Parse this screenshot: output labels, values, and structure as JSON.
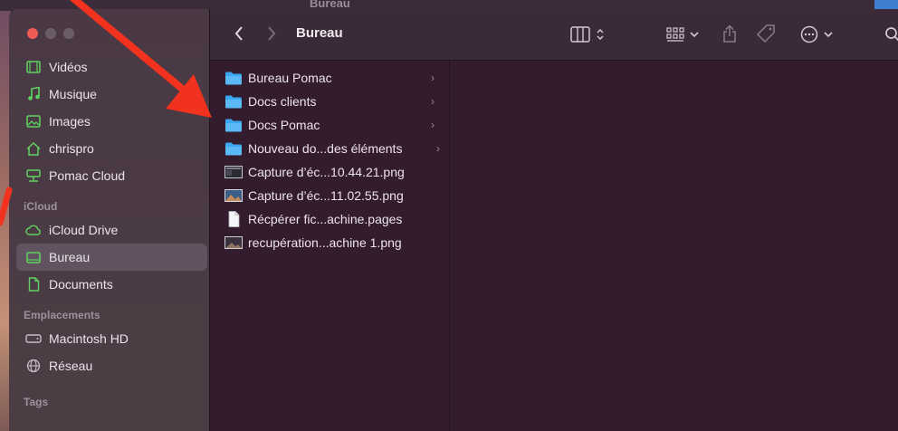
{
  "window": {
    "title": "Bureau"
  },
  "sidebar": {
    "items_top": [
      {
        "label": "Vidéos",
        "icon": "film-icon"
      },
      {
        "label": "Musique",
        "icon": "music-note-icon"
      },
      {
        "label": "Images",
        "icon": "photo-icon"
      },
      {
        "label": "chrispro",
        "icon": "home-icon"
      },
      {
        "label": "Pomac Cloud",
        "icon": "network-drive-icon"
      }
    ],
    "section_icloud": "iCloud",
    "items_icloud": [
      {
        "label": "iCloud Drive",
        "icon": "cloud-icon"
      },
      {
        "label": "Bureau",
        "icon": "desktop-icon",
        "selected": true
      },
      {
        "label": "Documents",
        "icon": "document-icon"
      }
    ],
    "section_locations": "Emplacements",
    "items_locations": [
      {
        "label": "Macintosh HD",
        "icon": "hard-drive-icon"
      },
      {
        "label": "Réseau",
        "icon": "globe-icon"
      }
    ],
    "section_tags": "Tags"
  },
  "files": [
    {
      "name": "Bureau Pomac",
      "type": "folder"
    },
    {
      "name": "Docs clients",
      "type": "folder"
    },
    {
      "name": "Docs Pomac",
      "type": "folder"
    },
    {
      "name": "Nouveau do...des éléments",
      "type": "folder"
    },
    {
      "name": "Capture d’éc...10.44.21.png",
      "type": "image"
    },
    {
      "name": "Capture d’éc...11.02.55.png",
      "type": "image"
    },
    {
      "name": "Récpérer fic...achine.pages",
      "type": "pages"
    },
    {
      "name": "recupération...achine 1.png",
      "type": "image"
    }
  ],
  "colors": {
    "accent_folder": "#3aa7f0",
    "sidebar_icon_green": "#5fd35f",
    "annotation_arrow": "#f0321e"
  }
}
